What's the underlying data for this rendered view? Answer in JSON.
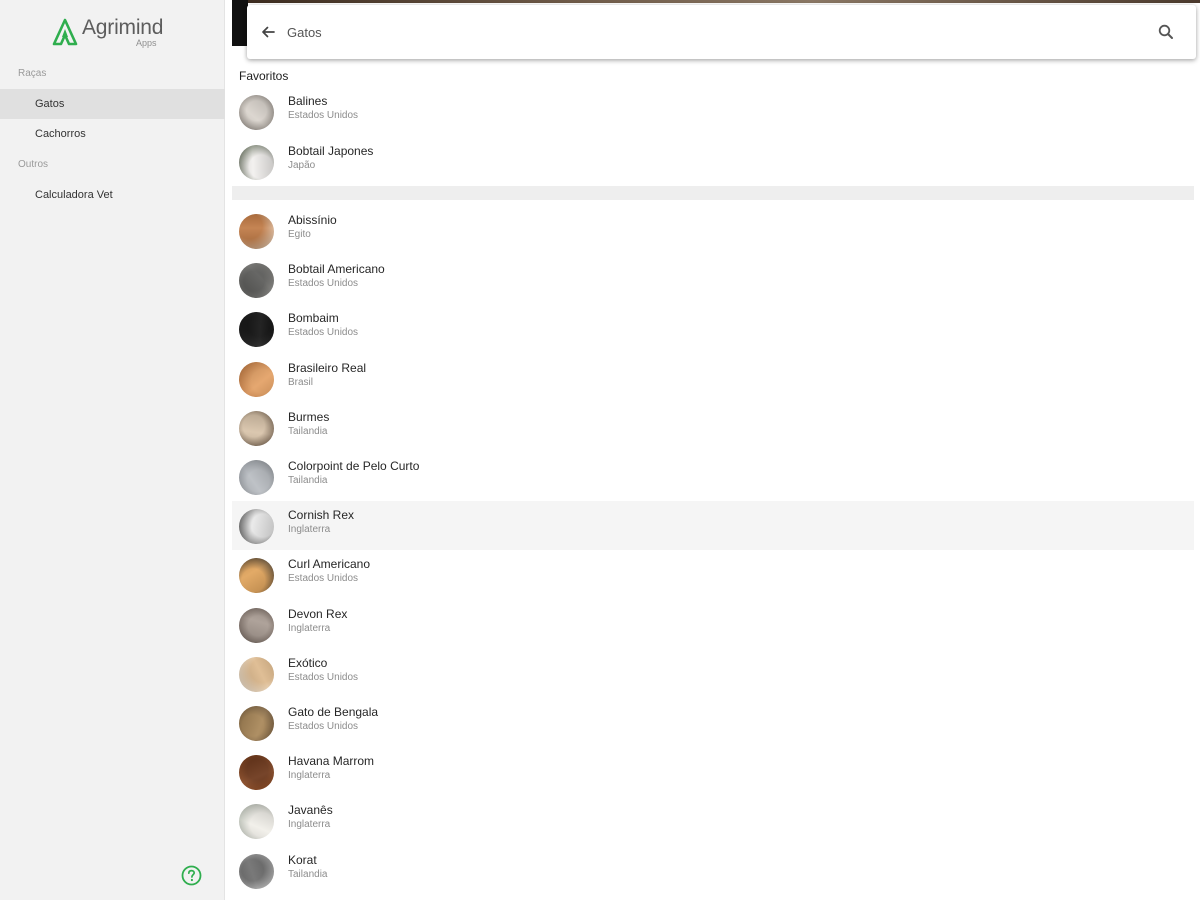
{
  "app": {
    "logo_name": "Agrimind",
    "logo_sub": "Apps",
    "accent": "#2fae4e"
  },
  "sidebar": {
    "section_racas": "Raças",
    "section_outros": "Outros",
    "items": [
      {
        "label": "Gatos",
        "active": true
      },
      {
        "label": "Cachorros",
        "active": false
      },
      {
        "label": "Calculadora Vet",
        "active": false
      }
    ],
    "help_icon": "help-circle-icon"
  },
  "search": {
    "value": "Gatos",
    "back_icon": "arrow-back-icon",
    "search_icon": "search-icon"
  },
  "favorites": {
    "header": "Favoritos",
    "items": [
      {
        "name": "Balines",
        "origin": "Estados Unidos",
        "avatar": [
          "#d9d3cc",
          "#6a635c"
        ]
      },
      {
        "name": "Bobtail Japones",
        "origin": "Japão",
        "avatar": [
          "#f2f0ee",
          "#3d4a32"
        ]
      }
    ]
  },
  "breeds": [
    {
      "name": "Abissínio",
      "origin": "Egito",
      "avatar": [
        "#c07a45",
        "#e8d9c8"
      ]
    },
    {
      "name": "Bobtail Americano",
      "origin": "Estados Unidos",
      "avatar": [
        "#5a5a58",
        "#8b8a86"
      ]
    },
    {
      "name": "Bombaim",
      "origin": "Estados Unidos",
      "avatar": [
        "#111111",
        "#2a2a2a"
      ]
    },
    {
      "name": "Brasileiro Real",
      "origin": "Brasil",
      "avatar": [
        "#e3a064",
        "#b86d35"
      ]
    },
    {
      "name": "Burmes",
      "origin": "Tailandia",
      "avatar": [
        "#d8c3a9",
        "#4a3727"
      ]
    },
    {
      "name": "Colorpoint de Pelo Curto",
      "origin": "Tailandia",
      "avatar": [
        "#b9bdc2",
        "#7e8389"
      ]
    },
    {
      "name": "Cornish Rex",
      "origin": "Inglaterra",
      "avatar": [
        "#e8e8e8",
        "#3a3a3a"
      ]
    },
    {
      "name": "Curl Americano",
      "origin": "Estados Unidos",
      "avatar": [
        "#e0a35a",
        "#1e1e1e"
      ]
    },
    {
      "name": "Devon Rex",
      "origin": "Inglaterra",
      "avatar": [
        "#a89b92",
        "#5a4c45"
      ]
    },
    {
      "name": "Exótico",
      "origin": "Estados Unidos",
      "avatar": [
        "#ddb98d",
        "#f3ece2"
      ]
    },
    {
      "name": "Gato de Bengala",
      "origin": "Estados Unidos",
      "avatar": [
        "#a88657",
        "#5b4630"
      ]
    },
    {
      "name": "Havana Marrom",
      "origin": "Inglaterra",
      "avatar": [
        "#6b3518",
        "#9c5428"
      ]
    },
    {
      "name": "Javanês",
      "origin": "Inglaterra",
      "avatar": [
        "#f1efe9",
        "#9da69a"
      ]
    },
    {
      "name": "Korat",
      "origin": "Tailandia",
      "avatar": [
        "#6e6e6e",
        "#d7d7d7"
      ]
    }
  ],
  "highlighted_breed": "Cornish Rex"
}
